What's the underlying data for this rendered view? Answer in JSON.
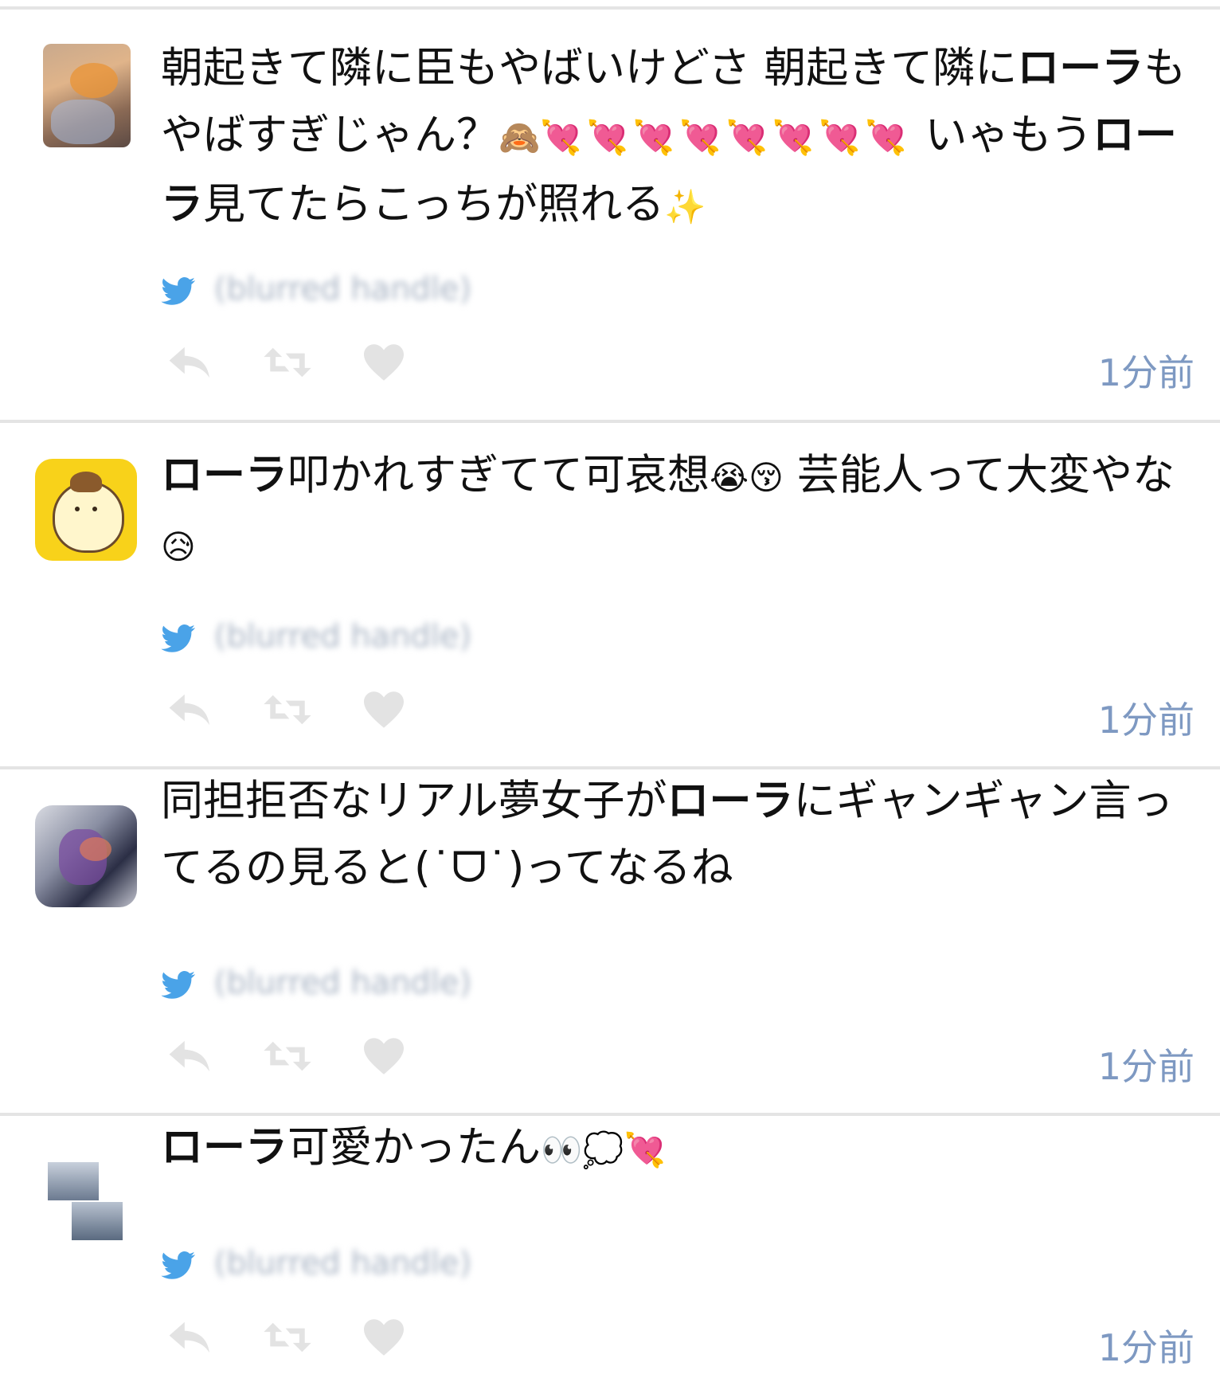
{
  "colors": {
    "twitter_blue": "#4aa3e8",
    "action_gray": "#e3e3e3",
    "timestamp": "#7e99c2",
    "divider": "#e4e4e4",
    "heart_red": "#e8202a"
  },
  "tweets": [
    {
      "text_a": "朝起きて隣に臣もやばいけどさ 朝起きて隣に",
      "keyword_a": "ロー",
      "keyword_b": "ラ",
      "text_b": "もやばすぎじゃん？",
      "emoji_a": "🙈",
      "emoji_hearts": "💘💘💘💘💘💘💘💘",
      "text_c": " いゃもう",
      "keyword_c": "ローラ",
      "text_d": "見てたらこっちが照れる",
      "emoji_b": "✨",
      "user": "(blurred handle)",
      "time": "1分前",
      "avatar_icon": "girl-photo-avatar"
    },
    {
      "keyword_a": "ローラ",
      "text_a": "叩かれすぎてて可哀想",
      "emoji_a": "😭😚",
      "text_b": " 芸能人って大変やな",
      "emoji_b": "😥",
      "user": "(blurred handle)",
      "time": "1分前",
      "avatar_icon": "pompompurin-avatar"
    },
    {
      "text_a": "同担拒否なリアル夢女子が",
      "keyword_a": "ローラ",
      "text_b": "にギャンギャン言ってるの見ると(˙ᗜ˙)ってなるね",
      "user": "(blurred handle)",
      "time": "1分前",
      "avatar_icon": "illustration-avatar"
    },
    {
      "keyword_a": "ローラ",
      "text_a": "可愛かったん",
      "emoji_a": "👀💭💘",
      "user": "(blurred handle)",
      "time": "1分前",
      "avatar_icon": "two-photo-avatar"
    }
  ]
}
